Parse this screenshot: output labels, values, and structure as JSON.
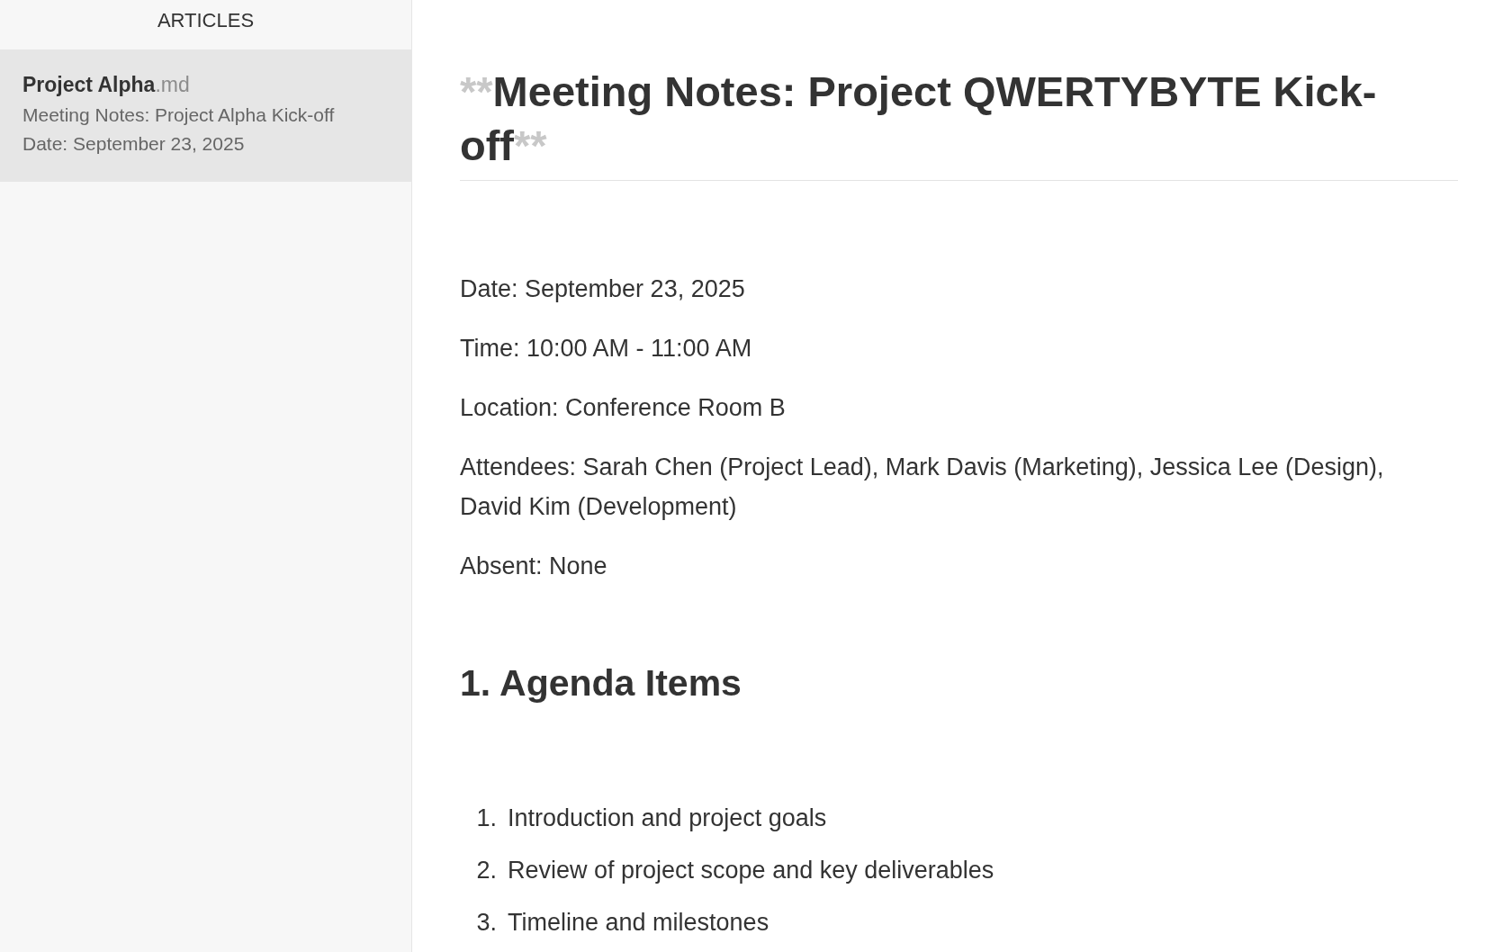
{
  "sidebar": {
    "header": "ARTICLES",
    "items": [
      {
        "name": "Project Alpha",
        "extension": ".md",
        "excerpt": [
          "Meeting Notes: Project Alpha Kick-off",
          "Date: September 23, 2025"
        ],
        "selected": true
      }
    ]
  },
  "document": {
    "title": {
      "open_marker": "**",
      "text": "Meeting Notes: Project QWERTYBYTE Kick-off",
      "close_marker": "**"
    },
    "paragraphs": [
      "Date: September 23, 2025",
      "Time: 10:00 AM - 11:00 AM",
      "Location: Conference Room B",
      "Attendees: Sarah Chen (Project Lead), Mark Davis (Marketing), Jessica Lee (Design), David Kim (Development)",
      "Absent: None"
    ],
    "section_heading": "1. Agenda Items",
    "list": [
      {
        "number": "1.",
        "text": "Introduction and project goals"
      },
      {
        "number": "2.",
        "text": "Review of project scope and key deliverables"
      },
      {
        "number": "3.",
        "text": "Timeline and milestones"
      }
    ]
  }
}
